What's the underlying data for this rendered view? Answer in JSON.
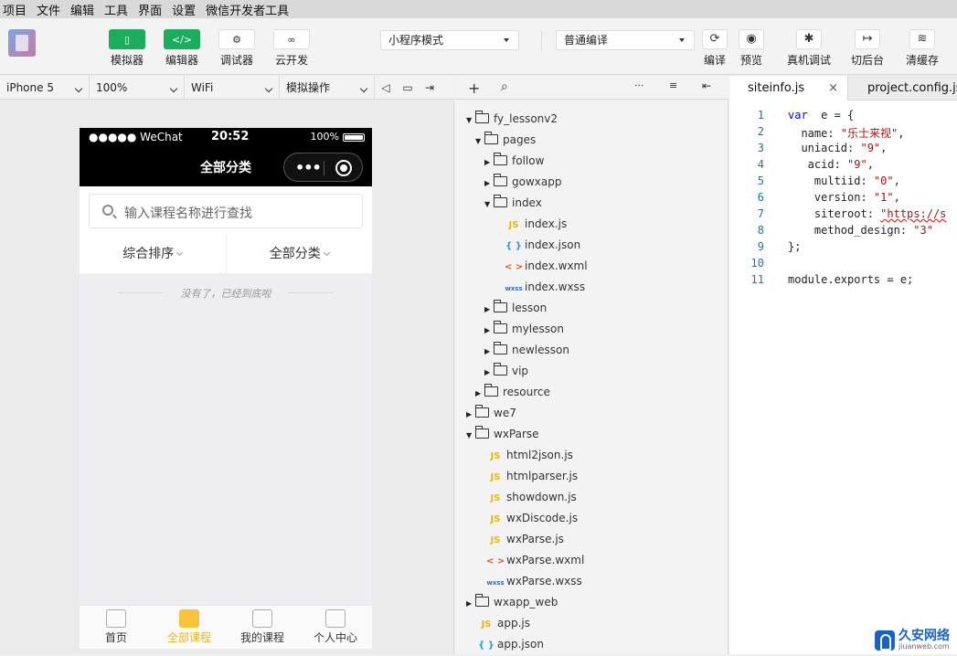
{
  "menubar": [
    "项目",
    "文件",
    "编辑",
    "工具",
    "界面",
    "设置",
    "微信开发者工具"
  ],
  "toolbar": {
    "left_buttons": [
      {
        "icon": "phone-icon",
        "label": "模拟器",
        "active": true
      },
      {
        "icon": "code-icon",
        "label": "编辑器",
        "active": true,
        "glyph": "</>"
      },
      {
        "icon": "debug-icon",
        "label": "调试器"
      },
      {
        "icon": "cloud-icon",
        "label": "云开发"
      }
    ],
    "mode_select": "小程序模式",
    "compile_select": "普通编译",
    "right_buttons": [
      {
        "icon": "refresh-icon",
        "label": "编译"
      },
      {
        "icon": "eye-icon",
        "label": "预览"
      },
      {
        "icon": "bug-icon",
        "label": "真机调试"
      },
      {
        "icon": "switch-background-icon",
        "label": "切后台"
      },
      {
        "icon": "layers-icon",
        "label": "清缓存"
      }
    ]
  },
  "simbar": {
    "device": "iPhone 5",
    "zoom": "100%",
    "network": "WiFi",
    "operation": "模拟操作"
  },
  "phone": {
    "carrier": "●●●●● WeChat",
    "time": "20:52",
    "battery": "100%",
    "nav_title": "全部分类",
    "search_placeholder": "输入课程名称进行查找",
    "filters": [
      "综合排序",
      "全部分类"
    ],
    "end_note": "没有了，已经到底啦",
    "tabs": [
      {
        "label": "首页",
        "icon": "home-icon"
      },
      {
        "label": "全部课程",
        "icon": "all-courses-icon",
        "active": true
      },
      {
        "label": "我的课程",
        "icon": "my-courses-icon"
      },
      {
        "label": "个人中心",
        "icon": "profile-icon"
      }
    ]
  },
  "tree": [
    {
      "name": "fy_lessonv2",
      "type": "folder",
      "open": true,
      "depth": 0
    },
    {
      "name": "pages",
      "type": "folder",
      "open": true,
      "depth": 1
    },
    {
      "name": "follow",
      "type": "folder",
      "open": false,
      "depth": 2
    },
    {
      "name": "gowxapp",
      "type": "folder",
      "open": false,
      "depth": 2
    },
    {
      "name": "index",
      "type": "folder",
      "open": true,
      "depth": 2
    },
    {
      "name": "index.js",
      "type": "js",
      "depth": 3
    },
    {
      "name": "index.json",
      "type": "json",
      "depth": 3
    },
    {
      "name": "index.wxml",
      "type": "wxml",
      "depth": 3
    },
    {
      "name": "index.wxss",
      "type": "wxss",
      "depth": 3
    },
    {
      "name": "lesson",
      "type": "folder",
      "open": false,
      "depth": 2
    },
    {
      "name": "mylesson",
      "type": "folder",
      "open": false,
      "depth": 2
    },
    {
      "name": "newlesson",
      "type": "folder",
      "open": false,
      "depth": 2
    },
    {
      "name": "vip",
      "type": "folder",
      "open": false,
      "depth": 2
    },
    {
      "name": "resource",
      "type": "folder",
      "open": false,
      "depth": 1
    },
    {
      "name": "we7",
      "type": "folder",
      "open": false,
      "depth": 0
    },
    {
      "name": "wxParse",
      "type": "folder",
      "open": true,
      "depth": 0
    },
    {
      "name": "html2json.js",
      "type": "js",
      "depth": 1
    },
    {
      "name": "htmlparser.js",
      "type": "js",
      "depth": 1
    },
    {
      "name": "showdown.js",
      "type": "js",
      "depth": 1
    },
    {
      "name": "wxDiscode.js",
      "type": "js",
      "depth": 1
    },
    {
      "name": "wxParse.js",
      "type": "js",
      "depth": 1
    },
    {
      "name": "wxParse.wxml",
      "type": "wxml",
      "depth": 1
    },
    {
      "name": "wxParse.wxss",
      "type": "wxss",
      "depth": 1
    },
    {
      "name": "wxapp_web",
      "type": "folder",
      "open": false,
      "depth": 0
    },
    {
      "name": "app.js",
      "type": "js",
      "depth": 0
    },
    {
      "name": "app.json",
      "type": "json",
      "depth": 0
    }
  ],
  "file_glyphs": {
    "js": "JS",
    "json": "{ }",
    "wxml": "< >",
    "wxss": "wxss"
  },
  "editor": {
    "tabs": [
      {
        "label": "siteinfo.js",
        "active": true,
        "close": "×"
      },
      {
        "label": "project.config.json",
        "active": false
      }
    ],
    "lines": [
      [
        [
          "kw",
          "var"
        ],
        [
          "",
          "  e = {"
        ]
      ],
      [
        [
          "",
          "  name: "
        ],
        [
          "str",
          "\"乐士来视\""
        ],
        [
          "",
          ","
        ]
      ],
      [
        [
          "",
          "  uniacid: "
        ],
        [
          "str",
          "\"9\""
        ],
        [
          "",
          ","
        ]
      ],
      [
        [
          "",
          "   acid: "
        ],
        [
          "str",
          "\"9\""
        ],
        [
          "",
          ","
        ]
      ],
      [
        [
          "",
          "    multiid: "
        ],
        [
          "str",
          "\"0\""
        ],
        [
          "",
          ","
        ]
      ],
      [
        [
          "",
          "    version: "
        ],
        [
          "str",
          "\"1\""
        ],
        [
          "",
          ","
        ]
      ],
      [
        [
          "",
          "    siteroot: "
        ],
        [
          "url",
          "\"https://s"
        ]
      ],
      [
        [
          "",
          "    method_design: "
        ],
        [
          "str",
          "\"3\""
        ]
      ],
      [
        [
          "",
          "};"
        ]
      ],
      [
        [
          "",
          ""
        ]
      ],
      [
        [
          "",
          "module.exports = e;"
        ]
      ]
    ]
  },
  "watermark": {
    "title": "久安网络",
    "subtitle": "jiuanweb.com"
  }
}
